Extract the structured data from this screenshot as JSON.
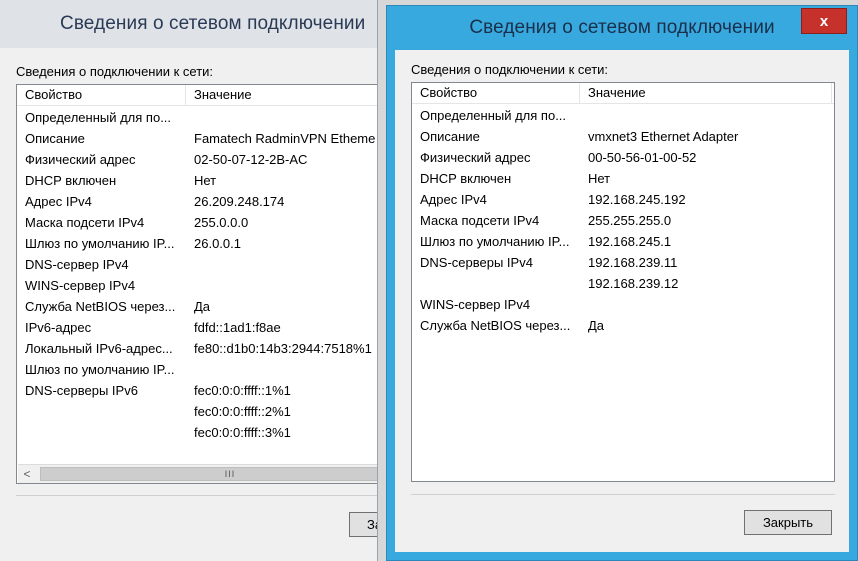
{
  "window1": {
    "title": "Сведения о сетевом подключении",
    "group_label": "Сведения о подключении к сети:",
    "columns": {
      "property": "Свойство",
      "value": "Значение"
    },
    "rows": [
      {
        "property": "Определенный для по...",
        "value": ""
      },
      {
        "property": "Описание",
        "value": "Famatech RadminVPN Etheme"
      },
      {
        "property": "Физический адрес",
        "value": "02-50-07-12-2B-AC"
      },
      {
        "property": "DHCP включен",
        "value": "Нет"
      },
      {
        "property": "Адрес IPv4",
        "value": "26.209.248.174"
      },
      {
        "property": "Маска подсети IPv4",
        "value": "255.0.0.0"
      },
      {
        "property": "Шлюз по умолчанию IP...",
        "value": "26.0.0.1"
      },
      {
        "property": "DNS-сервер IPv4",
        "value": ""
      },
      {
        "property": "WINS-сервер IPv4",
        "value": ""
      },
      {
        "property": "Служба NetBIOS через...",
        "value": "Да"
      },
      {
        "property": "IPv6-адрес",
        "value": "fdfd::1ad1:f8ae"
      },
      {
        "property": "Локальный IPv6-адрес...",
        "value": "fe80::d1b0:14b3:2944:7518%1"
      },
      {
        "property": "Шлюз по умолчанию IP...",
        "value": ""
      },
      {
        "property": "DNS-серверы IPv6",
        "value": "fec0:0:0:ffff::1%1"
      },
      {
        "property": "",
        "value": "fec0:0:0:ffff::2%1"
      },
      {
        "property": "",
        "value": "fec0:0:0:ffff::3%1"
      }
    ],
    "scrollbar": {
      "left_arrow": "<",
      "thumb_grip": "III"
    },
    "close_button_label": "За"
  },
  "window2": {
    "title": "Сведения о сетевом подключении",
    "close_glyph": "x",
    "group_label": "Сведения о подключении к сети:",
    "columns": {
      "property": "Свойство",
      "value": "Значение"
    },
    "rows": [
      {
        "property": "Определенный для по...",
        "value": ""
      },
      {
        "property": "Описание",
        "value": "vmxnet3 Ethernet Adapter"
      },
      {
        "property": "Физический адрес",
        "value": "00-50-56-01-00-52"
      },
      {
        "property": "DHCP включен",
        "value": "Нет"
      },
      {
        "property": "Адрес IPv4",
        "value": "192.168.245.192"
      },
      {
        "property": "Маска подсети IPv4",
        "value": "255.255.255.0"
      },
      {
        "property": "Шлюз по умолчанию IP...",
        "value": "192.168.245.1"
      },
      {
        "property": "DNS-серверы IPv4",
        "value": "192.168.239.11"
      },
      {
        "property": "",
        "value": "192.168.239.12"
      },
      {
        "property": "WINS-сервер IPv4",
        "value": ""
      },
      {
        "property": "Служба NetBIOS через...",
        "value": "Да"
      }
    ],
    "close_button_label": "Закрыть"
  },
  "colors": {
    "active_border": "#37a9de",
    "close_red": "#c7312b",
    "dialog_bg": "#f0f0f0"
  }
}
